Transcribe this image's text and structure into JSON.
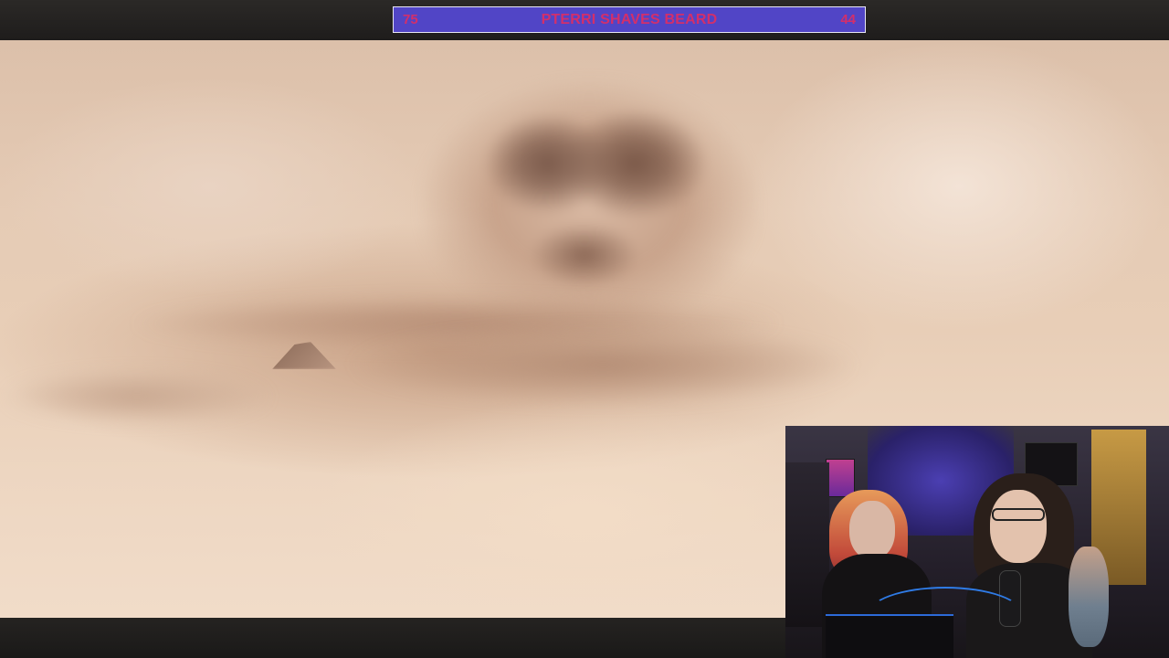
{
  "banner": {
    "left_number": "75",
    "title": "PTERRI SHAVES BEARD",
    "right_number": "44",
    "background_color": "#5145c6",
    "text_color": "#d32f6a"
  },
  "video": {
    "icon": "video-frame-desert-skull"
  },
  "webcam": {
    "icon": "webcam-feed"
  }
}
